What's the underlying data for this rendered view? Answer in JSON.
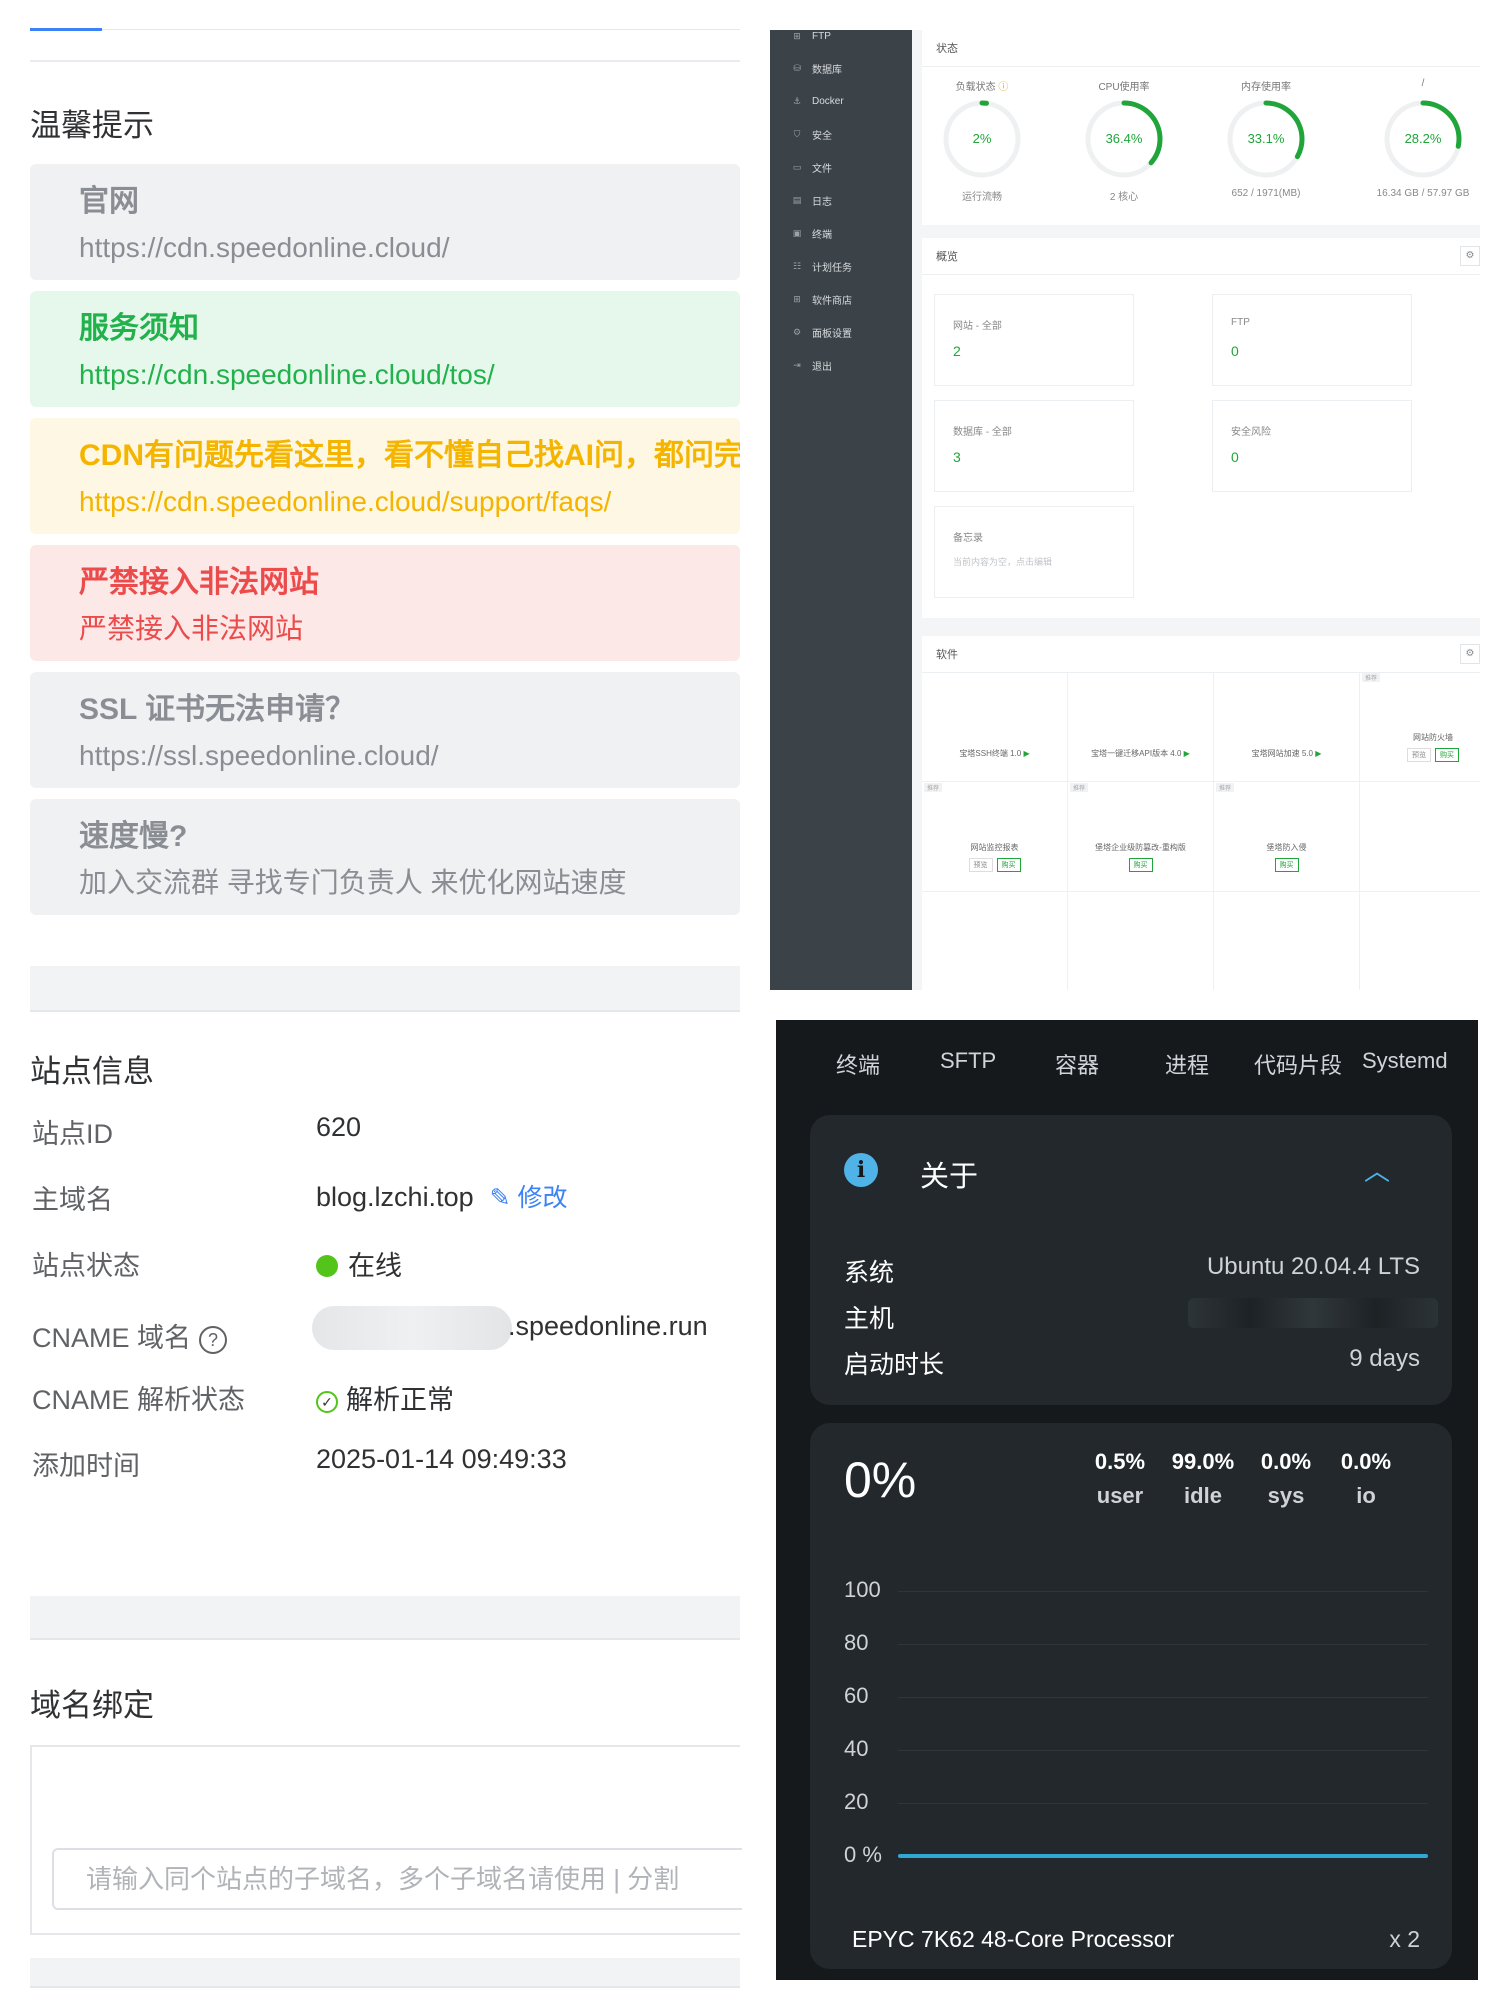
{
  "tips": {
    "heading": "温馨提示",
    "items": [
      {
        "title": "官网",
        "text": "https://cdn.speedonline.cloud/",
        "tone": "gray"
      },
      {
        "title": "服务须知",
        "text": "https://cdn.speedonline.cloud/tos/",
        "tone": "green"
      },
      {
        "title": "CDN有问题先看这里，看不懂自己找AI问，都问完",
        "text": "https://cdn.speedonline.cloud/support/faqs/",
        "tone": "yellow"
      },
      {
        "title": "严禁接入非法网站",
        "text": "严禁接入非法网站",
        "tone": "red"
      },
      {
        "title": "SSL 证书无法申请？",
        "text": "https://ssl.speedonline.cloud/",
        "tone": "gray"
      },
      {
        "title": "速度慢?",
        "text": "加入交流群 寻找专门负责人 来优化网站速度",
        "tone": "gray"
      }
    ]
  },
  "bt": {
    "sidebar": [
      {
        "icon": "⊞",
        "label": "FTP"
      },
      {
        "icon": "⛁",
        "label": "数据库"
      },
      {
        "icon": "⚓",
        "label": "Docker"
      },
      {
        "icon": "⛉",
        "label": "安全"
      },
      {
        "icon": "▭",
        "label": "文件"
      },
      {
        "icon": "▤",
        "label": "日志"
      },
      {
        "icon": "▣",
        "label": "终端"
      },
      {
        "icon": "☷",
        "label": "计划任务"
      },
      {
        "icon": "⊞",
        "label": "软件商店"
      },
      {
        "icon": "⚙",
        "label": "面板设置"
      },
      {
        "icon": "⇥",
        "label": "退出"
      }
    ],
    "status_title": "状态",
    "gauges": [
      {
        "label": "负载状态",
        "value": "2%",
        "fraction": 0.02,
        "sub": "运行流畅",
        "has_help": true
      },
      {
        "label": "CPU使用率",
        "value": "36.4%",
        "fraction": 0.364,
        "sub": "2 核心",
        "has_help": false
      },
      {
        "label": "内存使用率",
        "value": "33.1%",
        "fraction": 0.331,
        "sub": "652 / 1971(MB)",
        "has_help": false
      },
      {
        "label": "/",
        "value": "28.2%",
        "fraction": 0.282,
        "sub": "16.34 GB / 57.97 GB",
        "has_help": false
      }
    ],
    "overview_title": "概览",
    "overview": [
      {
        "label": "网站 - 全部",
        "value": "2"
      },
      {
        "label": "FTP",
        "value": "0"
      },
      {
        "label": "数据库 - 全部",
        "value": "3"
      },
      {
        "label": "安全风险",
        "value": "0"
      }
    ],
    "memo": {
      "label": "备忘录",
      "hint": "当前内容为空，点击编辑"
    },
    "software_title": "软件",
    "software": [
      {
        "name": "宝塔SSH终端 1.0",
        "tag": "",
        "kind": "run"
      },
      {
        "name": "宝塔一键迁移API版本 4.0",
        "tag": "",
        "kind": "run"
      },
      {
        "name": "宝塔网站加速 5.0",
        "tag": "",
        "kind": "run"
      },
      {
        "name": "网站防火墙",
        "tag": "推荐",
        "kind": "buy"
      },
      {
        "name": "网站监控报表",
        "tag": "推荐",
        "kind": "buy"
      },
      {
        "name": "堡塔企业级防篡改-重构版",
        "tag": "推荐",
        "kind": "buyonly"
      },
      {
        "name": "堡塔防入侵",
        "tag": "推荐",
        "kind": "buyonly"
      }
    ],
    "preview_label": "预览",
    "buy_label": "购买",
    "gear_icon": "gear-icon"
  },
  "site": {
    "heading": "站点信息",
    "rows": {
      "id": {
        "key": "站点ID",
        "value": "620"
      },
      "domain": {
        "key": "主域名",
        "value": "blog.lzchi.top",
        "action": "修改"
      },
      "status": {
        "key": "站点状态",
        "value": "在线"
      },
      "cname": {
        "key": "CNAME 域名",
        "value": ".speedonline.run"
      },
      "cname_status": {
        "key": "CNAME 解析状态",
        "value": "解析正常"
      },
      "added": {
        "key": "添加时间",
        "value": "2025-01-14 09:49:33"
      }
    },
    "binding_heading": "域名绑定",
    "binding_placeholder": "请输入同个站点的子域名，多个子域名请使用 | 分割"
  },
  "terminal": {
    "tabs": [
      "终端",
      "SFTP",
      "容器",
      "进程",
      "代码片段",
      "Systemd"
    ],
    "about_title": "关于",
    "about": {
      "system_key": "系统",
      "system_value": "Ubuntu 20.04.4 LTS",
      "host_key": "主机",
      "uptime_key": "启动时长",
      "uptime_value": "9 days"
    },
    "cpu": {
      "total": "0%",
      "stats": [
        {
          "value": "0.5%",
          "label": "user"
        },
        {
          "value": "99.0%",
          "label": "idle"
        },
        {
          "value": "0.0%",
          "label": "sys"
        },
        {
          "value": "0.0%",
          "label": "io"
        }
      ],
      "y_ticks": [
        "100",
        "80",
        "60",
        "40",
        "20",
        "0 %"
      ],
      "processor": "EPYC 7K62 48-Core Processor",
      "count": "x 2"
    }
  },
  "colors": {
    "bt_green": "#20a53a",
    "accent_blue": "#3b82f6",
    "online_green": "#52c41a",
    "term_cyan": "#2fa8d6"
  }
}
